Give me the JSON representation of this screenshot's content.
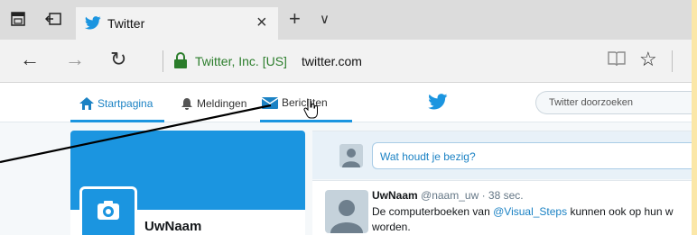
{
  "tab": {
    "title": "Twitter"
  },
  "icons": {
    "tab_preview": "tab-preview-icon",
    "tabs_aside": "tabs-aside-icon",
    "close": "×",
    "new_tab": "+",
    "more_tabs": "∨",
    "back": "←",
    "forward": "→",
    "refresh": "↻",
    "favorite": "☆"
  },
  "address": {
    "site_identity": "Twitter, Inc. [US]",
    "url": "twitter.com"
  },
  "twitter": {
    "nav": {
      "home": "Startpagina",
      "notifications": "Meldingen",
      "messages": "Berichten"
    },
    "search_placeholder": "Twitter doorzoeken",
    "compose_placeholder": "Wat houdt je bezig?",
    "profile_name": "UwNaam",
    "tweet": {
      "name": "UwNaam",
      "handle": "@naam_uw",
      "time": "· 38 sec.",
      "text_before": "De computerboeken van ",
      "mention": "@Visual_Steps",
      "text_after": " kunnen ook op hun w",
      "text_line2": "worden."
    }
  },
  "colors": {
    "twitter_blue": "#1b95e0",
    "secure_green": "#2b7d2b",
    "page_background": "#fbe7a8"
  }
}
